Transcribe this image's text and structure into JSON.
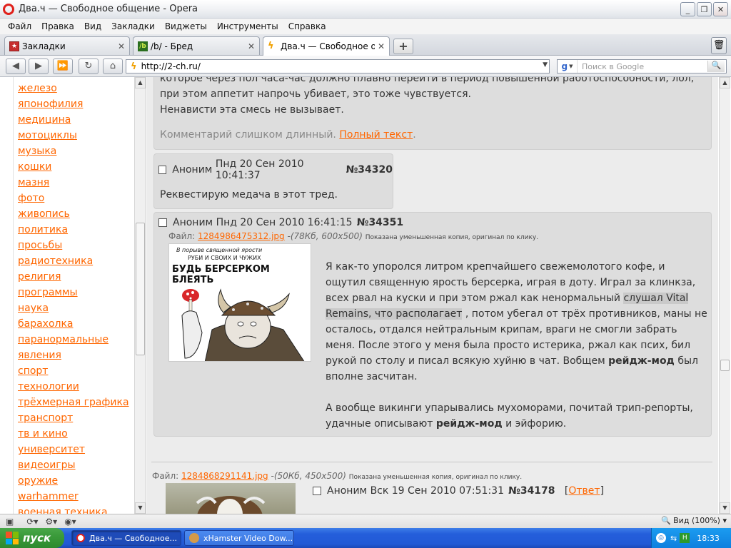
{
  "window": {
    "title": "Два.ч — Свободное общение - Opera"
  },
  "menu": [
    "Файл",
    "Правка",
    "Вид",
    "Закладки",
    "Виджеты",
    "Инструменты",
    "Справка"
  ],
  "tabs": [
    {
      "label": "Закладки"
    },
    {
      "label": "/b/ - Бред"
    },
    {
      "label": "Два.ч — Свободное об..."
    }
  ],
  "address": {
    "url": "http://2-ch.ru/",
    "search_placeholder": "Поиск в Google"
  },
  "sidebar": {
    "items": [
      "железо",
      "японофилия",
      "медицина",
      "мотоциклы",
      "музыка",
      "кошки",
      "мазня",
      "фото",
      "живопись",
      "политика",
      "просьбы",
      "радиотехника",
      "религия",
      "программы",
      "наука",
      "барахолка",
      "паранормальные",
      "явления",
      "спорт",
      "технологии",
      "трёхмерная графика",
      "транспорт",
      "тв и кино",
      "университет",
      "видеоигры",
      "оружие",
      "warhammer",
      "военная техника"
    ]
  },
  "posts": {
    "top": {
      "line0": "которое через пол часа-час должно плавно перейти в период повышенной работоспособности, лол,",
      "line1": "при этом аппетит напрочь убивает, это тоже чувствуется.",
      "line2": "Ненависти эта смесь не вызывает.",
      "truncated": "Комментарий слишком длинный.",
      "full_text_link": "Полный текст"
    },
    "p34320": {
      "author": "Аноним",
      "date": "Пнд 20 Сен 2010 10:41:37",
      "number": "№34320",
      "text": "Реквестирую медача в этот тред."
    },
    "p34351": {
      "author": "Аноним",
      "date": "Пнд 20 Сен 2010 16:41:15",
      "number": "№34351",
      "file_label": "Файл:",
      "file_name": "1284986475312.jpg",
      "file_meta": "-(78Кб, 600x500)",
      "file_note": "Показана уменьшенная копия, оригинал по клику.",
      "image_caption_1": "В порыве священной ярости",
      "image_caption_2": "РУБИ И СВОИХ И ЧУЖИХ",
      "image_caption_3": "БУДЬ БЕРСЕРКОМ БЛЕЯТЬ",
      "lines": [
        "Я как-то упоролся литром крепчайшего свежемолотого кофе, и",
        "ощутил священную ярость берсерка, играя в доту. Играл за клинкза,",
        "всех рвал на куски и при этом ржал как ненормальный",
        "слушал Vital",
        "Remains, что располагает",
        ", потом убегал от трёх противников, маны не",
        "осталось, отдался нейтральным крипам, враги не смогли забрать",
        "меня. После этого у меня была просто истерика, ржал как псих, бил",
        "рукой по столу и писал всякую хуйню в чат. Вобщем",
        "рейдж-мод",
        "был",
        "вполне засчитан.",
        "А вообще викинги упарывались мухоморами, почитай трип-репорты,",
        "удачные описывают",
        "рейдж-мод",
        "и эйфорию."
      ]
    },
    "p34178": {
      "file_label": "Файл:",
      "file_name": "1284868291141.jpg",
      "file_meta": "-(50Кб, 450x500)",
      "file_note": "Показана уменьшенная копия, оригинал по клику.",
      "author": "Аноним",
      "date": "Вск 19 Сен 2010 07:51:31",
      "number": "№34178",
      "reply_open": "[",
      "reply": "Ответ",
      "reply_close": "]"
    }
  },
  "status": {
    "zoom": "Вид (100%)"
  },
  "taskbar": {
    "start": "пуск",
    "items": [
      "Два.ч — Свободное...",
      "xHamster Video Dow..."
    ],
    "lang": "EN",
    "time": "18:33"
  },
  "colors": {
    "link": "#ff6600",
    "post_bg": "#dddddd",
    "page_bg": "#ececec",
    "taskbar": "#245edb",
    "start": "#3a9a3a"
  }
}
